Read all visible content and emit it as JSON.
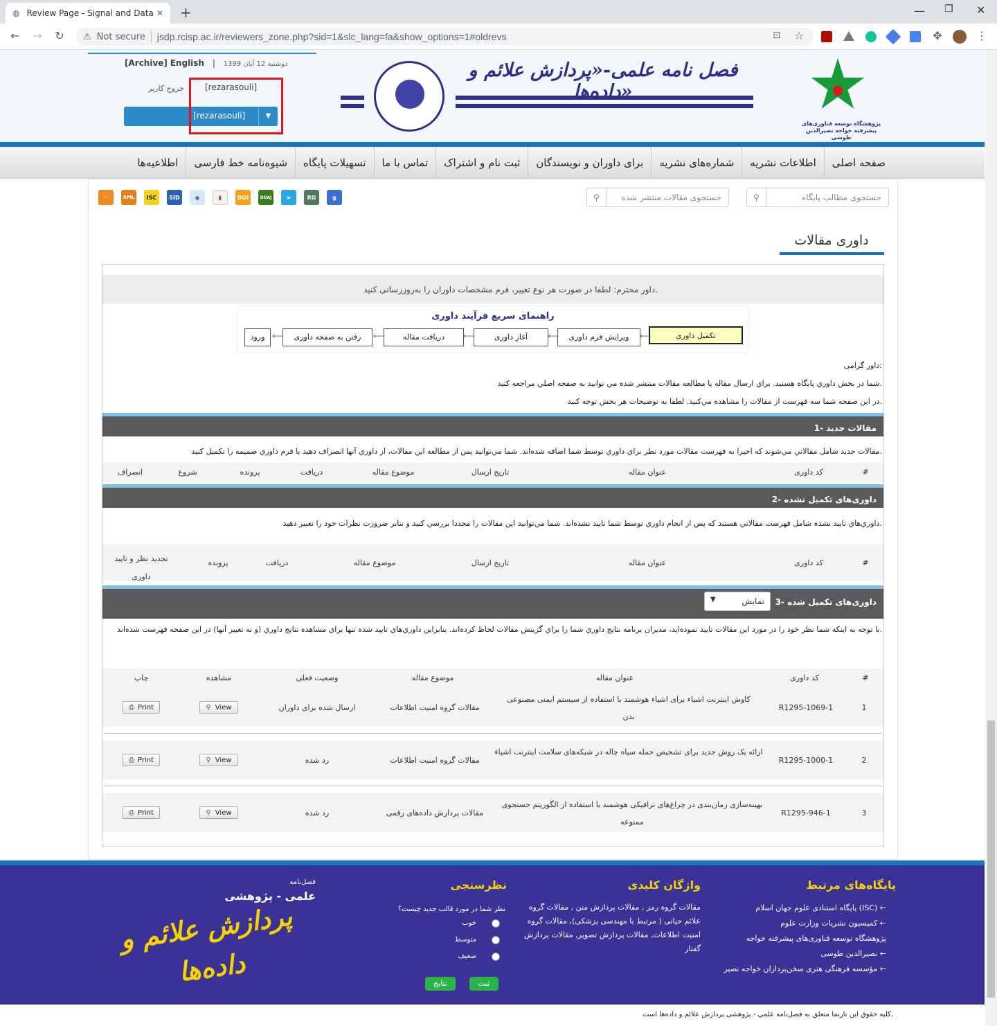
{
  "browser": {
    "tab_title": "Review Page - Signal and Data Pr",
    "not_secure": "Not secure",
    "url": "jsdp.rcisp.ac.ir/reviewers_zone.php?sid=1&slc_lang=fa&show_options=1#oldrevs"
  },
  "header": {
    "archive": "[Archive]",
    "english": "English",
    "date": "دوشنبه 12 آبان 1399",
    "logout": "خروج کاربر",
    "username": "[rezarasouli]",
    "dropdown_value": "[rezarasouli]",
    "journal_title": "فصل نامه علمی-«پردازش علائم و داده‌ها»",
    "org_name": "پژوهشگاه توسعه فناوری‌های پیشرفته خواجه نصیرالدین طوسی"
  },
  "nav": [
    "صفحه اصلی",
    "اطلاعات نشریه",
    "شماره‌های نشریه",
    "برای داوران و نویسندگان",
    "ثبت نام و اشتراک",
    "تماس با ما",
    "تسهیلات پایگاه",
    "شیوه‌نامه خط فارسی",
    "اطلاعیه‌ها"
  ],
  "search": {
    "site_placeholder": "جستجوی مطالب پایگاه",
    "articles_placeholder": "جستجوی مقالات منتشر شده"
  },
  "icons": [
    "rss-icon",
    "xml-icon",
    "isc-icon",
    "sid-icon",
    "eye-icon",
    "book-icon",
    "doi-icon",
    "doaj-icon",
    "telegram-icon",
    "researchgate-icon",
    "google-scholar-icon"
  ],
  "page_title": "داوری مقالات",
  "notice": "داور محترم: لطفا در صورت هر نوع تغییر، فرم مشخصات داوران را به‌روزرسانی کنید.",
  "guide": {
    "title": "راهنمای سریع فرآیند داوری",
    "steps": [
      "تکمیل داوری",
      "ویرایش فرم داوری",
      "آغاز داوری",
      "دریافت مقاله",
      "رفتن به صفحه داوری",
      "ورود"
    ]
  },
  "intro": {
    "greeting": "داور گرامی:",
    "line1": "شما در بخش داوري پايگاه هستيد. براي ارسال مقاله يا مطالعه مقالات منتشر شده مي توانيد به صفحه اصلي مراجعه كنيد.",
    "line2": "در اين صفحه شما سه فهرست از مقالات را مشاهده مي‌كنيد. لطفا به توضيحات هر بخش توجه كنيد."
  },
  "section1": {
    "title": "1- مقالات جدید",
    "desc": "مقالات جديد شامل مقالاتي مي‌شوند كه اخيرا به فهرست مقالات مورد نظر براي داوري توسط شما اضافه شده‌اند. شما مي‌توانيد پس از مطالعه اين مقالات، از داوري آنها انصراف دهيد يا فرم داوري ضميمه را تكميل كنيد.",
    "headers": [
      "#",
      "كد داوری",
      "عنوان مقاله",
      "تاريخ ارسال",
      "موضوع مقاله",
      "دريافت",
      "پرونده",
      "شروع",
      "انصراف"
    ]
  },
  "section2": {
    "title": "2- داوری‌های تکمیل نشده",
    "desc": "داوري‌هاي تاييد نشده شامل فهرست مقالاتي هستند كه پس از انجام داوري توسط شما تاييد نشده‌اند. شما مي‌توانيد اين مقالات را مجددا بررسي كنيد و بنابر ضرورت نظرات خود را تغيير دهيد.",
    "headers": [
      "#",
      "كد داوری",
      "عنوان مقاله",
      "تاريخ ارسال",
      "موضوع مقاله",
      "دريافت",
      "پرونده",
      "تجديد نظر و تاييد داوری"
    ]
  },
  "section3": {
    "title": "3- داوری‌های تکمیل شده",
    "select": "نمایش",
    "desc": "با توجه به اينكه شما نظر خود را در مورد اين مقالات تاييد نموده‌ايد، مديران برنامه نتايج داوري شما را براي گزينش مقالات لحاظ كرده‌اند. بنابراين داوري‌هاي تاييد شده تنها براي مشاهده نتايج داوري (و نه تغيير آنها) در اين صفحه فهرست شده‌اند.",
    "headers": [
      "#",
      "كد داوری",
      "عنوان مقاله",
      "موضوع مقاله",
      "وضعيت فعلی",
      "مشاهده",
      "چاپ"
    ],
    "rows": [
      {
        "n": "1",
        "code": "R1295-1069-1",
        "title": "کاوش اینترنت اشیاء برای اشیاء هوشمند با استفاده از سیستم ایمنی مصنوعی بدن",
        "subject": "مقالات گروه امنیت اطلاعات",
        "status": "ارسال شده برای داوران",
        "view": "View",
        "print": "Print"
      },
      {
        "n": "2",
        "code": "R1295-1000-1",
        "title": "ارائه یک روش جدید برای تشخیص حمله سیاه چاله در شبکه‌های سلامت اینترنت اشیاء",
        "subject": "مقالات گروه امنیت اطلاعات",
        "status": "رد شده",
        "view": "View",
        "print": "Print"
      },
      {
        "n": "3",
        "code": "R1295-946-1",
        "title": "بهینه‌سازی زمان‌بندی در چراغ‌های ترافیکی هوشمند با استفاده از الگوریتم جستجوی ممنوعه",
        "subject": "مقالات پردازش داده‌های رقمی",
        "status": "رد شده",
        "view": "View",
        "print": "Print"
      }
    ]
  },
  "footer": {
    "related_title": "پایگاه‌های مرتبط",
    "related": [
      "پایگاه استنادی علوم جهان اسلام (ISC)",
      "کمیسیون نشریات وزارت علوم",
      "پژوهشگاه توسعه فناوری‌های پیشرفته خواجه نصیرالدین طوسی",
      "مؤسسه فرهنگی هنری سخن‌پردازان خواجه نصیر"
    ],
    "keywords_title": "واژگان کلیدی",
    "keywords": "مقالات گروه رمز , مقالات پردازش متن , مقالات گروه علائم حیاتی ( مرتبط با مهندسی پزشکی), مقالات گروه امنیت اطلاعات, مقالات پردازش تصویر, مقالات پردازش گفتار",
    "poll_title": "نظرسنجی",
    "poll_question": "نظر شما در مورد قالب جدید چیست؟",
    "poll_options": [
      "خوب",
      "متوسط",
      "ضعیف"
    ],
    "poll_submit": "ثبت",
    "poll_results": "نتایج",
    "logo_small": "فصل‌نامه",
    "logo_sub": "علمی - پژوهشی",
    "logo_main": "پردازش علائم و داده‌ها",
    "copyright": "کلیه حقوق این تارنما متعلق به فصل‌نامه علمی - پژوهشی پردازش علائم و داده‌ها است."
  }
}
